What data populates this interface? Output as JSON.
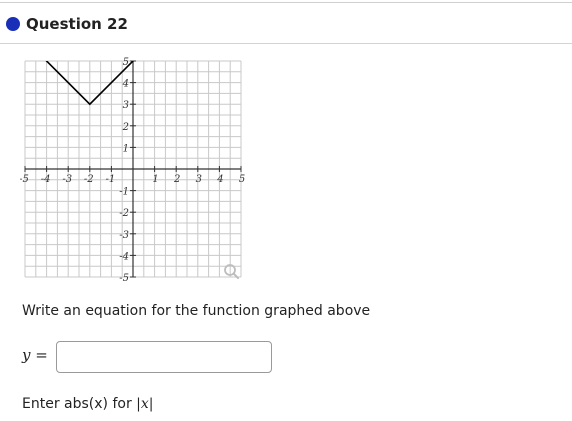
{
  "question": {
    "title": "Question 22",
    "status_color": "#1a2fb8"
  },
  "graph": {
    "x_tick_labels": [
      "-5",
      "-4",
      "-3",
      "-2",
      "-1",
      "1",
      "2",
      "3",
      "4",
      "5"
    ],
    "y_tick_labels": [
      "5",
      "4",
      "3",
      "2",
      "1",
      "-1",
      "-2",
      "-3",
      "-4",
      "-5"
    ],
    "xlim": [
      -5,
      5
    ],
    "ylim": [
      -5,
      5
    ],
    "grid": true,
    "function_points": [
      [
        -4.5,
        5.5
      ],
      [
        -2,
        3
      ],
      [
        0.5,
        5.5
      ]
    ],
    "line_color": "#000000",
    "zoom_icon": "magnifier-icon"
  },
  "prompt": "Write an equation for the function graphed above",
  "answer": {
    "label_var": "y",
    "label_eq": " =",
    "value": "",
    "placeholder": ""
  },
  "hint": {
    "prefix": "Enter abs(x) for ",
    "bar": "|",
    "var": "x"
  }
}
